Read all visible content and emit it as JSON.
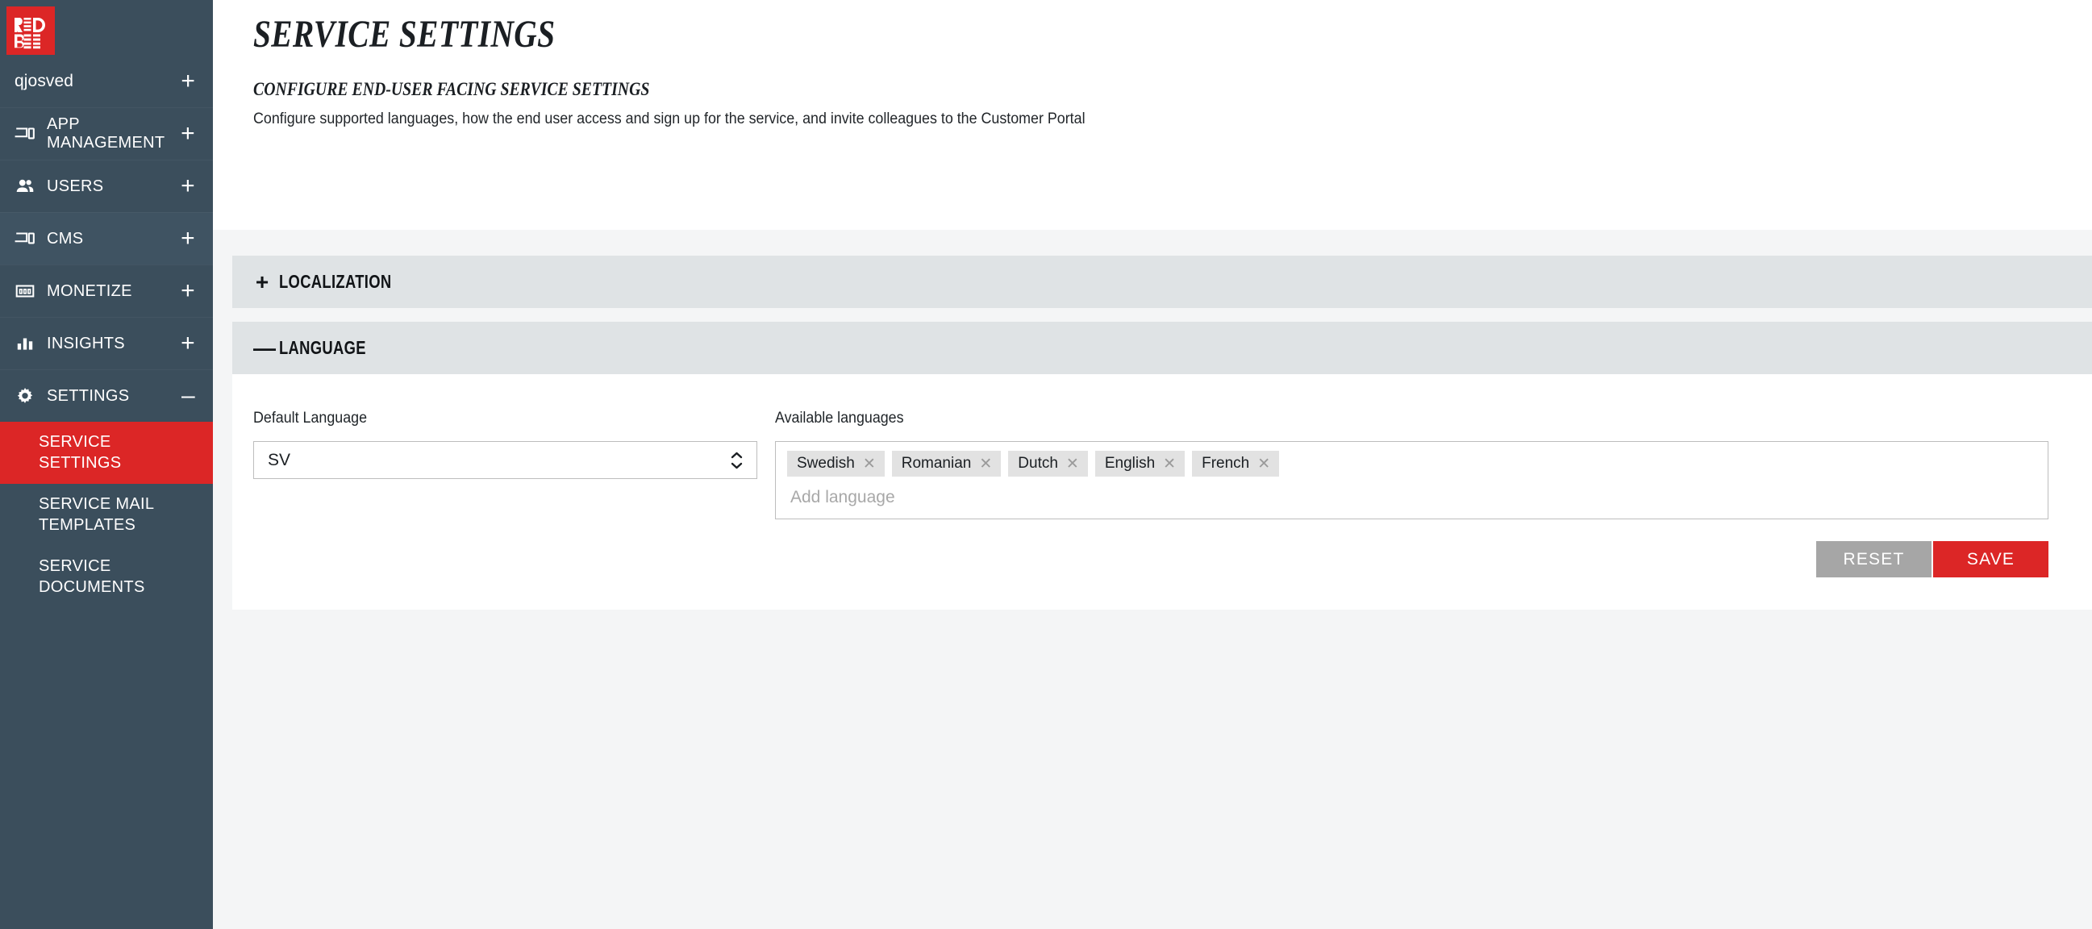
{
  "brand": {
    "logo_line1": "RED",
    "logo_line2": "BEE",
    "color": "#dc2626"
  },
  "sidebar": {
    "account": {
      "label": "qjosved",
      "expand": "+"
    },
    "items": [
      {
        "label": "APP MANAGEMENT",
        "icon": "devices-icon",
        "expand": "+",
        "state": "normal"
      },
      {
        "label": "USERS",
        "icon": "people-icon",
        "expand": "+",
        "state": "normal"
      },
      {
        "label": "CMS",
        "icon": "devices-icon",
        "expand": "+",
        "state": "hovered"
      },
      {
        "label": "MONETIZE",
        "icon": "money-icon",
        "expand": "+",
        "state": "normal"
      },
      {
        "label": "INSIGHTS",
        "icon": "bar-chart-icon",
        "expand": "+",
        "state": "normal"
      },
      {
        "label": "SETTINGS",
        "icon": "gear-icon",
        "expand": "–",
        "state": "expanded"
      }
    ],
    "subitems": [
      {
        "label": "SERVICE SETTINGS",
        "active": true
      },
      {
        "label": "SERVICE MAIL TEMPLATES",
        "active": false
      },
      {
        "label": "SERVICE DOCUMENTS",
        "active": false
      }
    ]
  },
  "page": {
    "title": "SERVICE SETTINGS",
    "subtitle": "CONFIGURE END-USER FACING SERVICE SETTINGS",
    "description": "Configure supported languages, how the end user access and sign up for the service, and invite colleagues to the Customer Portal"
  },
  "sections": {
    "localization": {
      "sign": "+",
      "title": "LOCALIZATION",
      "expanded": false
    },
    "language": {
      "sign": "—",
      "title": "LANGUAGE",
      "expanded": true
    }
  },
  "language_form": {
    "default_language_label": "Default Language",
    "default_language_value": "SV",
    "available_languages_label": "Available languages",
    "tags": [
      {
        "label": "Swedish",
        "remove": "✕"
      },
      {
        "label": "Romanian",
        "remove": "✕"
      },
      {
        "label": "Dutch",
        "remove": "✕"
      },
      {
        "label": "English",
        "remove": "✕"
      },
      {
        "label": "French",
        "remove": "✕"
      }
    ],
    "add_placeholder": "Add language",
    "reset_label": "RESET",
    "save_label": "SAVE"
  }
}
